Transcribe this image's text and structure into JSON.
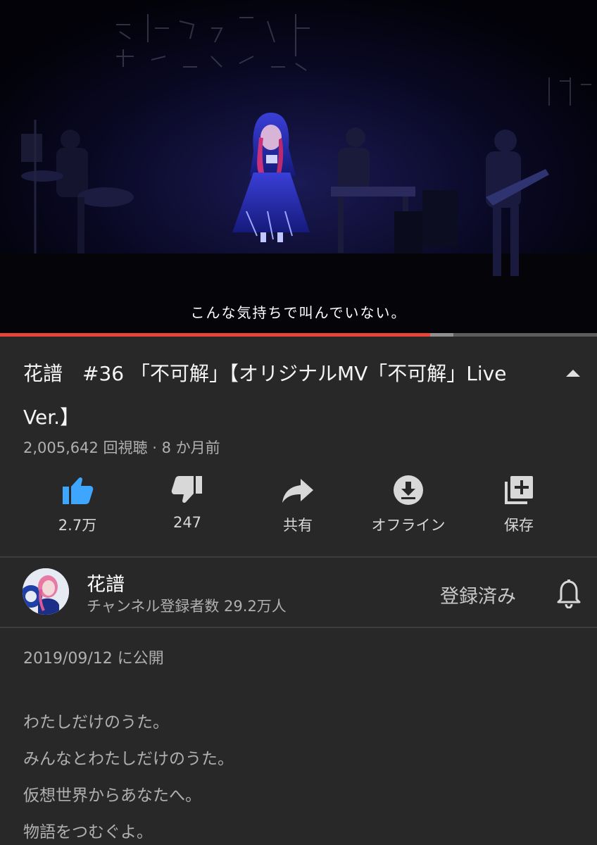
{
  "video": {
    "subtitle": "こんな気持ちで叫んでいない。",
    "progress_fraction": 0.72,
    "buffer_fraction": 0.76,
    "colors": {
      "played": "#e9443a",
      "background": "#05040c"
    }
  },
  "title": "花譜　#36 「不可解」【オリジナルMV「不可解」Live Ver.】",
  "meta": "2,005,642 回視聴 · 8 か月前",
  "actions": [
    {
      "icon": "thumbs-up-icon",
      "label": "2.7万",
      "active": true
    },
    {
      "icon": "thumbs-down-icon",
      "label": "247",
      "active": false
    },
    {
      "icon": "share-icon",
      "label": "共有",
      "active": false
    },
    {
      "icon": "download-icon",
      "label": "オフライン",
      "active": false
    },
    {
      "icon": "save-playlist-icon",
      "label": "保存",
      "active": false
    }
  ],
  "channel": {
    "name": "花譜",
    "subscribers": "チャンネル登録者数 29.2万人",
    "subscribe_state": "登録済み"
  },
  "description": {
    "published": "2019/09/12 に公開",
    "lines": [
      "わたしだけのうた。",
      "みんなとわたしだけのうた。",
      "仮想世界からあなたへ。",
      "物語をつむぐよ。"
    ]
  },
  "accent_color": "#3ea6ff"
}
